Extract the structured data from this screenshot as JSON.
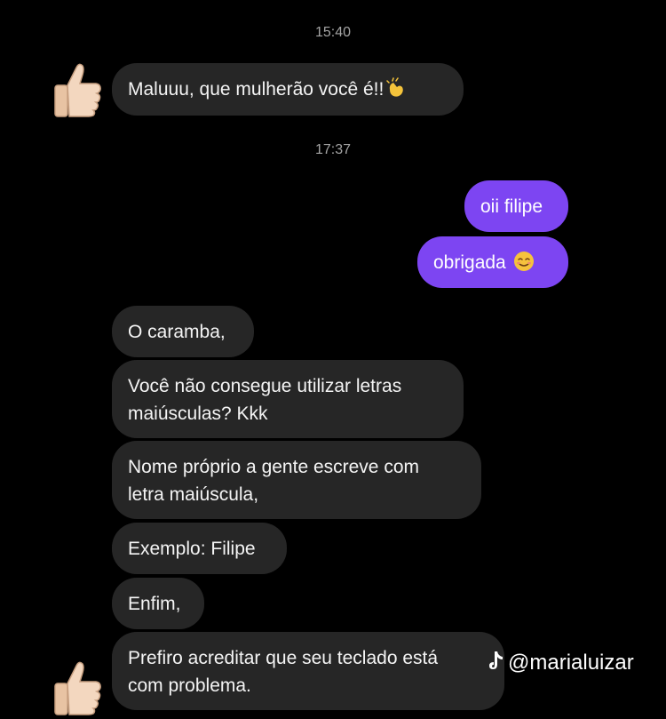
{
  "conversation": {
    "timestamp_1": "15:40",
    "timestamp_2": "17:37",
    "messages": [
      {
        "side": "received",
        "text": "Maluuu, que mulherão você é!!",
        "emoji": "clapping-hands"
      },
      {
        "side": "sent",
        "text": "oii filipe"
      },
      {
        "side": "sent",
        "text": "obrigada",
        "emoji": "smiling-face"
      },
      {
        "side": "received",
        "text": "O caramba,"
      },
      {
        "side": "received",
        "line1": "Você não consegue utilizar letras",
        "line2": "maiúsculas? Kkk"
      },
      {
        "side": "received",
        "line1": "Nome próprio a gente escreve com",
        "line2": "letra maiúscula,"
      },
      {
        "side": "received",
        "text": "Exemplo: Filipe"
      },
      {
        "side": "received",
        "text": "Enfim,"
      },
      {
        "side": "received",
        "line1": "Prefiro acreditar que seu teclado está",
        "line2": "com problema."
      }
    ]
  },
  "avatar_icon": "thumbs-up",
  "watermark": {
    "icon": "tiktok-icon",
    "handle": "@marialuizar"
  },
  "colors": {
    "background": "#000000",
    "received_bubble": "#262626",
    "sent_bubble": "#7d45f2",
    "timestamp": "#a5a5a5"
  }
}
